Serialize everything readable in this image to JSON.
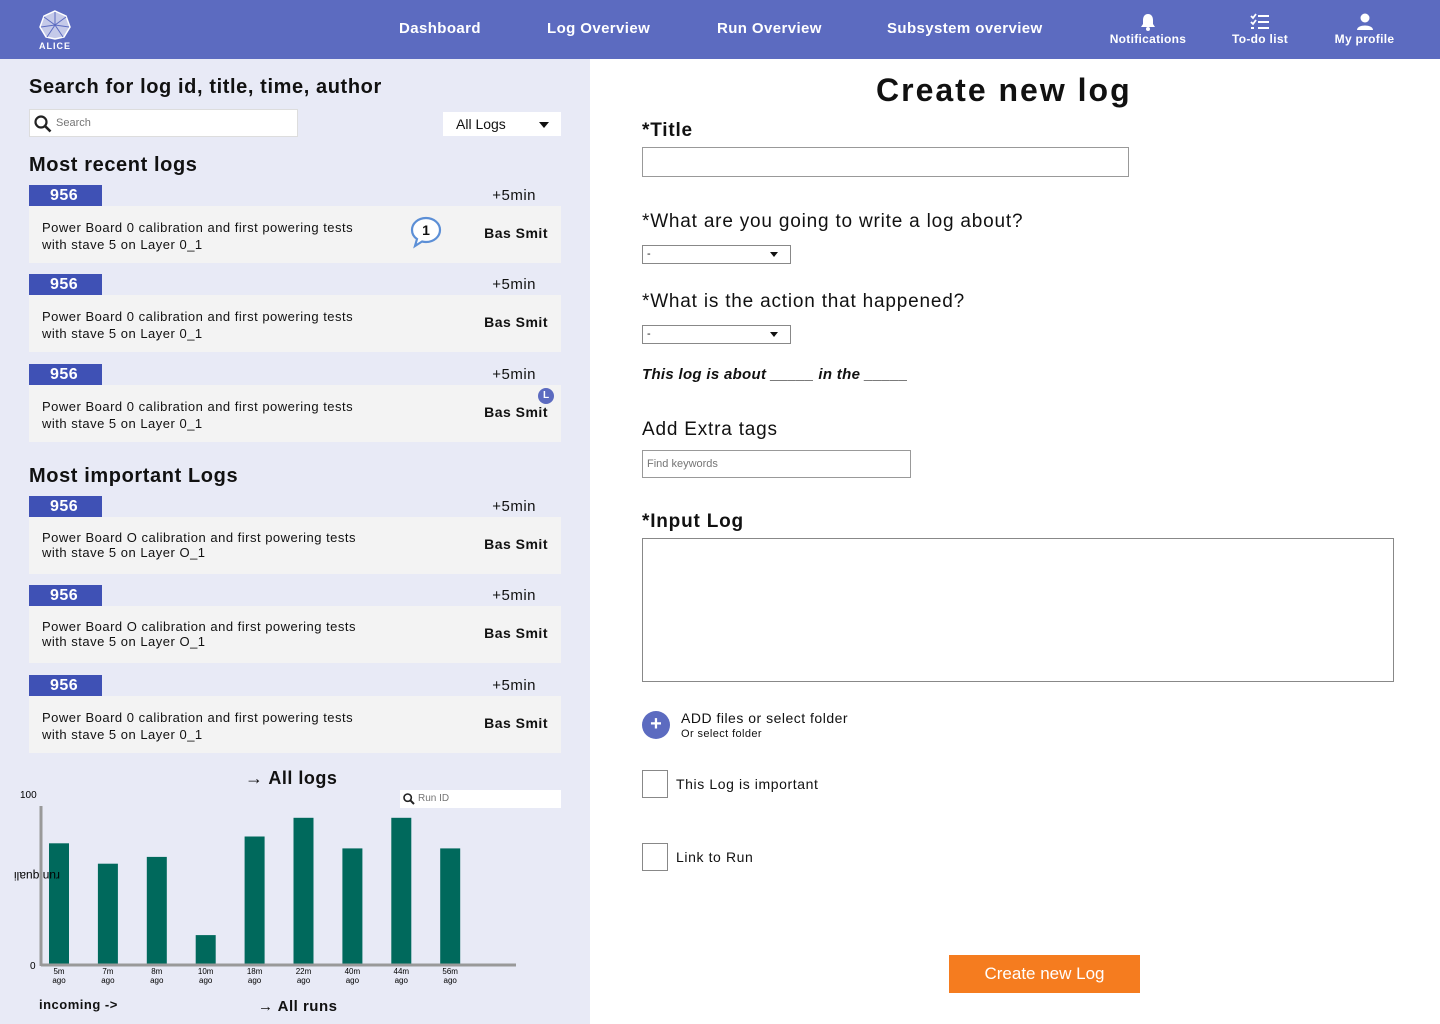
{
  "header": {
    "logo_text": "ALICE",
    "nav": [
      "Dashboard",
      "Log Overview",
      "Run Overview",
      "Subsystem overview"
    ],
    "notifications_label": "Notifications",
    "todo_label": "To-do list",
    "profile_label": "My profile"
  },
  "sidebar": {
    "search_heading": "Search for log id, title, time, author",
    "search_placeholder": "Search",
    "filter_value": "All Logs",
    "recent_title": "Most recent logs",
    "important_title": "Most important Logs",
    "recent_logs": [
      {
        "id": "956",
        "time": "+5min",
        "text": "Power Board 0 calibration and first powering tests with stave 5 on Layer 0_1",
        "author": "Bas Smit",
        "comments": "1"
      },
      {
        "id": "956",
        "time": "+5min",
        "text": "Power Board 0 calibration and first powering tests with stave 5 on Layer 0_1",
        "author": "Bas Smit"
      },
      {
        "id": "956",
        "time": "+5min",
        "text": "Power Board 0 calibration and first powering tests with stave 5 on Layer 0_1",
        "author": "Bas Smit",
        "badge": "L"
      }
    ],
    "important_logs": [
      {
        "id": "956",
        "time": "+5min",
        "text": "Power Board O calibration and first powering tests with stave 5 on Layer O_1",
        "author": "Bas Smit"
      },
      {
        "id": "956",
        "time": "+5min",
        "text": "Power Board O calibration and first powering tests with stave 5 on Layer O_1",
        "author": "Bas Smit"
      },
      {
        "id": "956",
        "time": "+5min",
        "text": "Power Board 0 calibration and first powering tests with stave 5 on Layer 0_1",
        "author": "Bas Smit"
      }
    ],
    "all_logs_label": "All logs",
    "run_id_placeholder": "Run ID",
    "incoming_label": "incoming ->",
    "all_runs_label": "All runs"
  },
  "chart_data": {
    "type": "bar",
    "categories": [
      "5m ago",
      "7m ago",
      "8m ago",
      "10m ago",
      "18m ago",
      "22m ago",
      "40m ago",
      "44m ago",
      "56m ago"
    ],
    "values": [
      71,
      59,
      63,
      17,
      75,
      86,
      68,
      86,
      68
    ],
    "ylabel": "run quali",
    "ylim": [
      0,
      100
    ],
    "yticks": [
      "0",
      "100"
    ],
    "bar_color": "#00695c"
  },
  "form": {
    "title": "Create new log",
    "title_label": "*Title",
    "about_label": "*What are you going to write a log about?",
    "about_value": "-",
    "action_label": "*What is the action that happened?",
    "action_value": "-",
    "sentence": "This log is about _____ in the _____",
    "tags_label": "Add Extra tags",
    "tags_placeholder": "Find keywords",
    "input_label": "*Input Log",
    "add_files_label": "ADD files or select folder",
    "add_files_sub": "Or select folder",
    "important_label": "This Log is important",
    "link_label": "Link to Run",
    "submit_label": "Create new Log"
  },
  "colors": {
    "header": "#5c6bc0",
    "log_id": "#3f51b5",
    "submit": "#f57c1f",
    "sidebar_bg": "#e8eaf6"
  }
}
